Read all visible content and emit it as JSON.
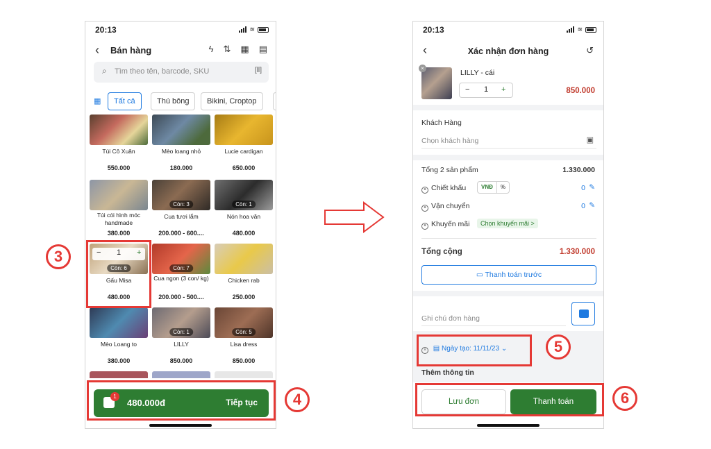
{
  "left_phone": {
    "status_time": "20:13",
    "header": {
      "title": "Bán hàng"
    },
    "search": {
      "placeholder": "Tìm theo tên, barcode, SKU"
    },
    "categories": [
      "Tất cả",
      "Thú bông",
      "Bikini, Croptop"
    ],
    "products": [
      {
        "name": "Túi Cô Xuân",
        "price": "550.000",
        "badge": ""
      },
      {
        "name": "Mèo loang nhỏ",
        "price": "180.000",
        "badge": ""
      },
      {
        "name": "Lucie cardigan",
        "price": "650.000",
        "badge": ""
      },
      {
        "name": "Túi cói hình móc handmade",
        "price": "380.000",
        "badge": ""
      },
      {
        "name": "Cua tươi lắm",
        "price": "200.000 - 600....",
        "badge": "Còn: 3"
      },
      {
        "name": "Nón hoa văn",
        "price": "480.000",
        "badge": "Còn: 1"
      },
      {
        "name": "Gấu Misa",
        "price": "480.000",
        "badge": "Còn: 6"
      },
      {
        "name": "Cua ngon (3 con/ kg)",
        "price": "200.000 - 500....",
        "badge": "Còn: 7"
      },
      {
        "name": "Chicken rab",
        "price": "250.000",
        "badge": ""
      },
      {
        "name": "Mèo Loang to",
        "price": "380.000",
        "badge": ""
      },
      {
        "name": "LILLY",
        "price": "850.000",
        "badge": "Còn: 1"
      },
      {
        "name": "Lisa dress",
        "price": "850.000",
        "badge": "Còn: 5"
      }
    ],
    "selected_stepper": {
      "minus": "−",
      "qty": "1",
      "plus": "+"
    },
    "cart": {
      "badge": "1",
      "total": "480.000đ",
      "continue_label": "Tiếp tục"
    }
  },
  "right_phone": {
    "status_time": "20:13",
    "header": {
      "title": "Xác nhận đơn hàng"
    },
    "order_item": {
      "name": "LILLY - cái",
      "qty": "1",
      "minus": "−",
      "plus": "+",
      "price": "850.000",
      "remove": "×"
    },
    "customer": {
      "label": "Khách Hàng",
      "placeholder": "Chọn khách hàng"
    },
    "summary": {
      "products_label": "Tổng 2 sản phẩm",
      "products_value": "1.330.000",
      "discount_label": "Chiết khấu",
      "discount_vnd": "VNĐ",
      "discount_pct": "%",
      "discount_value": "0",
      "shipping_label": "Vận chuyển",
      "shipping_value": "0",
      "promo_label": "Khuyến mãi",
      "promo_chip": "Chọn khuyến mãi >",
      "total_label": "Tổng cộng",
      "total_value": "1.330.000"
    },
    "prepay_label": "Thanh toán trước",
    "note_placeholder": "Ghi chú đơn hàng",
    "date_label": "Ngày tạo: 11/11/23",
    "more_info_label": "Thêm thông tin",
    "save_label": "Lưu đơn",
    "pay_label": "Thanh toán"
  },
  "annotations": {
    "step3": "3",
    "step4": "4",
    "step5": "5",
    "step6": "6"
  },
  "colors": {
    "brand_green": "#2e7d32",
    "accent_blue": "#1f7ae0",
    "price_red": "#c0392b",
    "annotation_red": "#e53935"
  }
}
